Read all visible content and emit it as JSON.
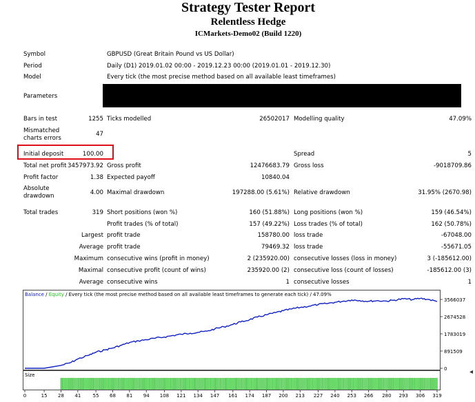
{
  "report": {
    "title": "Strategy Tester Report",
    "expert": "Relentless Hedge",
    "account": "ICMarkets-Demo02 (Build 1220)"
  },
  "settings": {
    "symbol_label": "Symbol",
    "symbol_value": "GBPUSD (Great Britain Pound vs US Dollar)",
    "period_label": "Period",
    "period_value": "Daily (D1) 2019.01.02 00:00 - 2019.12.23 00:00 (2019.01.01 - 2019.12.30)",
    "model_label": "Model",
    "model_value": "Every tick (the most precise method based on all available least timeframes)",
    "parameters_label": "Parameters"
  },
  "stats": {
    "bars_label": "Bars in test",
    "bars_value": "1255",
    "ticks_label": "Ticks modelled",
    "ticks_value": "26502017",
    "quality_label": "Modelling quality",
    "quality_value": "47.09%",
    "mismatch_label_1": "Mismatched",
    "mismatch_label_2": "charts errors",
    "mismatch_value": "47",
    "deposit_label": "Initial deposit",
    "deposit_value": "100.00",
    "spread_label": "Spread",
    "spread_value": "5",
    "netprofit_label": "Total net profit",
    "netprofit_value": "3457973.92",
    "grossprofit_label": "Gross profit",
    "grossprofit_value": "12476683.79",
    "grossloss_label": "Gross loss",
    "grossloss_value": "-9018709.86",
    "pf_label": "Profit factor",
    "pf_value": "1.38",
    "ep_label": "Expected payoff",
    "ep_value": "10840.04",
    "absdd_label_1": "Absolute",
    "absdd_label_2": "drawdown",
    "absdd_value": "4.00",
    "maxdd_label": "Maximal drawdown",
    "maxdd_value": "197288.00 (5.61%)",
    "reldd_label": "Relative drawdown",
    "reldd_value": "31.95% (2670.98)",
    "trades_label": "Total trades",
    "trades_value": "319",
    "short_label": "Short positions (won %)",
    "short_value": "160 (51.88%)",
    "long_label": "Long positions (won %)",
    "long_value": "159 (46.54%)",
    "pt_label": "Profit trades (% of total)",
    "pt_value": "157 (49.22%)",
    "lt_label": "Loss trades (% of total)",
    "lt_value": "162 (50.78%)",
    "largest_label": "Largest",
    "lpt_label": "profit trade",
    "lpt_value": "158780.00",
    "llt_label": "loss trade",
    "llt_value": "-67048.00",
    "average_label": "Average",
    "apt_label": "profit trade",
    "apt_value": "79469.32",
    "alt_label": "loss trade",
    "alt_value": "-55671.05",
    "maximum_label": "Maximum",
    "mcw_label": "consecutive wins (profit in money)",
    "mcw_value": "2 (235920.00)",
    "mcl_label": "consecutive losses (loss in money)",
    "mcl_value": "3 (-185612.00)",
    "maximal_label": "Maximal",
    "mcp_label": "consecutive profit (count of wins)",
    "mcp_value": "235920.00 (2)",
    "mclc_label": "consecutive loss (count of losses)",
    "mclc_value": "-185612.00 (3)",
    "average2_label": "Average",
    "acw_label": "consecutive wins",
    "acw_value": "1",
    "acl_label": "consecutive losses",
    "acl_value": "1"
  },
  "chart_data": {
    "type": "line",
    "legend": [
      "Balance",
      "Equity"
    ],
    "header_rest": " / Every tick (the most precise method based on all available least timeframes to generate each tick) / 47.09%",
    "y_ticks": [
      "3566037",
      "2674528",
      "1783019",
      "891509",
      "0"
    ],
    "ylim": [
      0,
      3566037
    ],
    "x_ticks": [
      "0",
      "15",
      "28",
      "41",
      "55",
      "68",
      "81",
      "94",
      "108",
      "121",
      "134",
      "147",
      "161",
      "174",
      "187",
      "200",
      "213",
      "227",
      "240",
      "253",
      "266",
      "280",
      "293",
      "306",
      "319"
    ],
    "xlim": [
      0,
      319
    ],
    "size_label": "Size",
    "series": [
      {
        "name": "Balance",
        "color": "#1020c0",
        "x": [
          0,
          15,
          28,
          35,
          41,
          50,
          55,
          62,
          68,
          75,
          81,
          88,
          94,
          101,
          108,
          115,
          121,
          128,
          134,
          141,
          147,
          154,
          161,
          167,
          174,
          180,
          187,
          194,
          200,
          207,
          213,
          220,
          227,
          233,
          240,
          246,
          253,
          259,
          266,
          272,
          280,
          286,
          293,
          300,
          306,
          312,
          319
        ],
        "y": [
          100,
          100,
          150000,
          280000,
          480000,
          690000,
          830000,
          950000,
          1050000,
          1200000,
          1330000,
          1420000,
          1480000,
          1560000,
          1620000,
          1700000,
          1760000,
          1820000,
          1860000,
          1920000,
          2040000,
          2150000,
          2270000,
          2400000,
          2520000,
          2650000,
          2770000,
          2880000,
          2980000,
          3080000,
          3150000,
          3220000,
          3300000,
          3350000,
          3420000,
          3470000,
          3540000,
          3510000,
          3470000,
          3500000,
          3480000,
          3530000,
          3600000,
          3560000,
          3620000,
          3570000,
          3458074
        ]
      }
    ],
    "size_bars_from": 28,
    "size_bar_color": "#19c019"
  },
  "colors": {
    "balance": "#1020c0",
    "equity": "#19c019",
    "highlight": "#e0101a",
    "border": "#4a4a4a"
  }
}
